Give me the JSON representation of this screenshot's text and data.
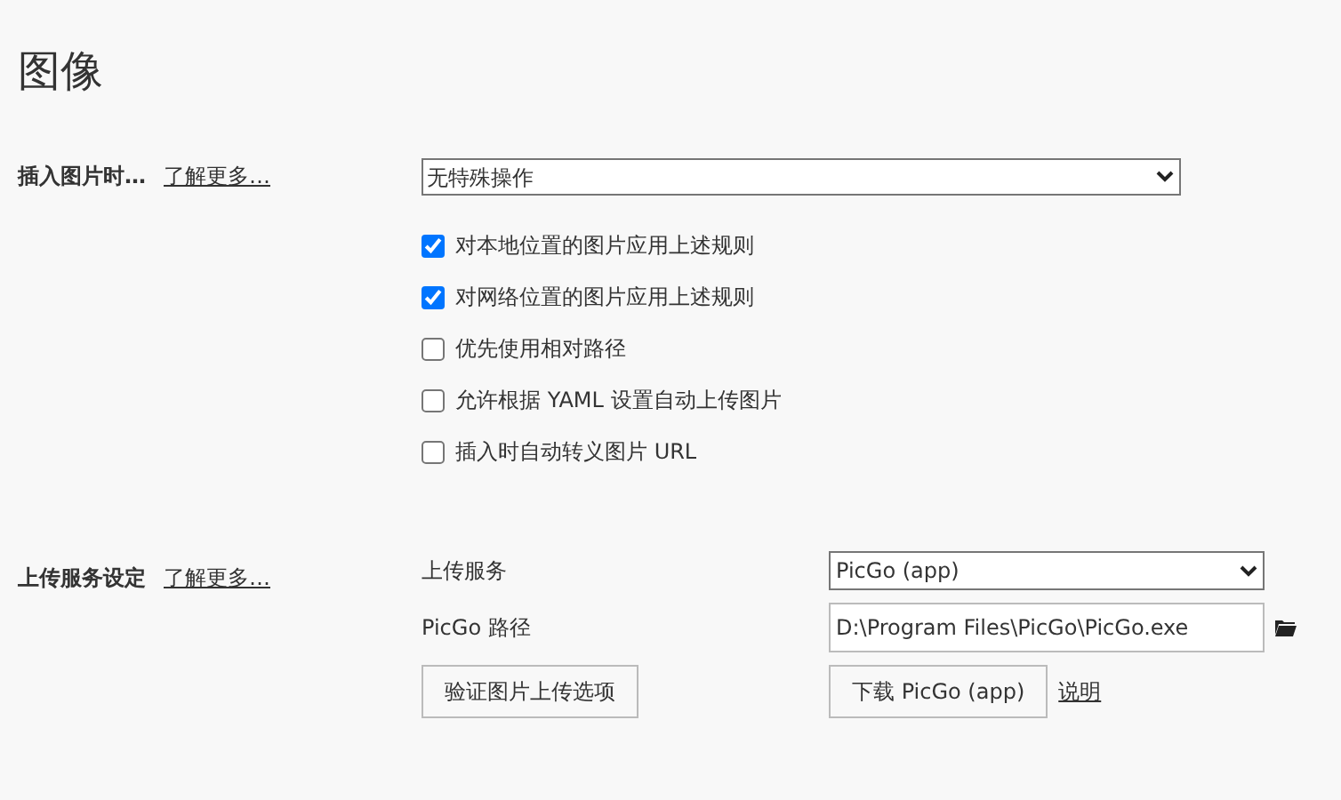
{
  "title": "图像",
  "insert_section": {
    "label": "插入图片时…",
    "learn_more": "了解更多…",
    "select": {
      "value": "无特殊操作"
    },
    "options": [
      {
        "label": "对本地位置的图片应用上述规则",
        "checked": true
      },
      {
        "label": "对网络位置的图片应用上述规则",
        "checked": true
      },
      {
        "label": "优先使用相对路径",
        "checked": false
      },
      {
        "label": "允许根据 YAML 设置自动上传图片",
        "checked": false
      },
      {
        "label": "插入时自动转义图片 URL",
        "checked": false
      }
    ]
  },
  "upload_section": {
    "label": "上传服务设定",
    "learn_more": "了解更多…",
    "service_label": "上传服务",
    "service_value": "PicGo (app)",
    "path_label": "PicGo 路径",
    "path_value": "D:\\Program Files\\PicGo\\PicGo.exe",
    "verify_button": "验证图片上传选项",
    "download_button": "下载 PicGo (app)",
    "help_link": "说明"
  }
}
